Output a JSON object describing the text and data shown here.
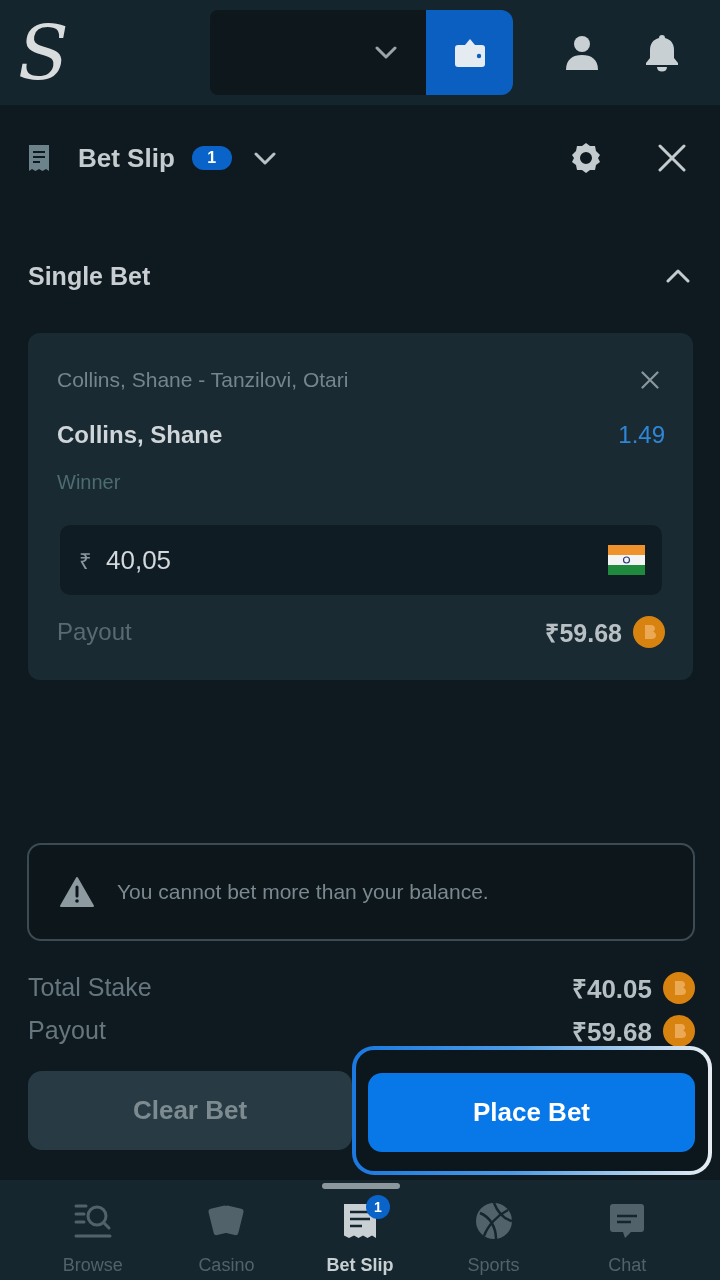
{
  "header": {
    "logo": "S"
  },
  "bet_slip_header": {
    "title": "Bet Slip",
    "count": "1"
  },
  "section": {
    "title": "Single Bet",
    "expanded": true
  },
  "bet": {
    "event": "Collins, Shane - Tanzilovi, Otari",
    "selection": "Collins, Shane",
    "odds": "1.49",
    "market": "Winner",
    "stake": {
      "currency_symbol": "₹",
      "value": "40,05"
    },
    "payout_label": "Payout",
    "payout_value": "₹59.68"
  },
  "warning": {
    "message": "You cannot bet more than your balance."
  },
  "summary": [
    {
      "label": "Total Stake",
      "value": "₹40.05"
    },
    {
      "label": "Payout",
      "value": "₹59.68"
    }
  ],
  "actions": [
    {
      "label": "Clear Bet",
      "kind": "secondary",
      "highlighted": false
    },
    {
      "label": "Place Bet",
      "kind": "primary",
      "highlighted": true
    }
  ],
  "bottom_nav": [
    {
      "label": "Browse",
      "selected": false
    },
    {
      "label": "Casino",
      "selected": false
    },
    {
      "label": "Bet Slip",
      "selected": true,
      "badge": "1"
    },
    {
      "label": "Sports",
      "selected": false
    },
    {
      "label": "Chat",
      "selected": false
    }
  ]
}
